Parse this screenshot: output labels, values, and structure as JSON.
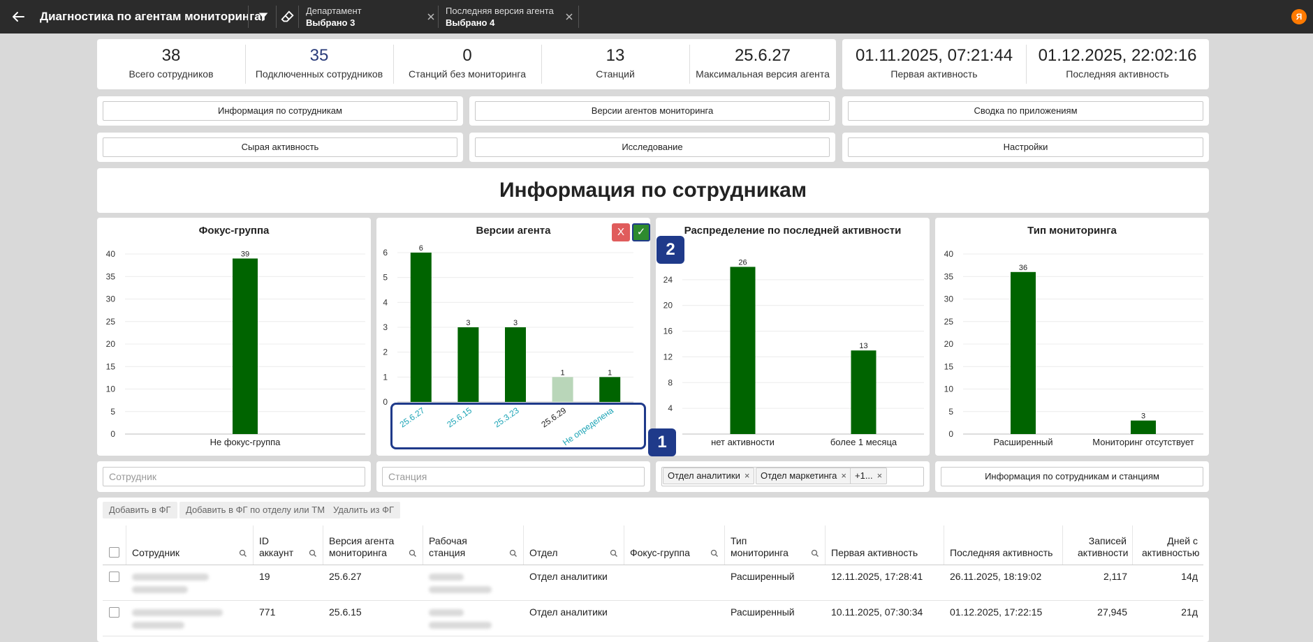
{
  "header": {
    "title": "Диагностика по агентам мониторинга",
    "filters": [
      {
        "label": "Департамент",
        "value": "Выбрано 3"
      },
      {
        "label": "Последняя версия агента",
        "value": "Выбрано 4"
      }
    ],
    "avatar": "Я"
  },
  "kpis": [
    {
      "value": "38",
      "label": "Всего сотрудников"
    },
    {
      "value": "35",
      "label": "Подключенных сотрудников"
    },
    {
      "value": "0",
      "label": "Станций без мониторинга"
    },
    {
      "value": "13",
      "label": "Станций"
    },
    {
      "value": "25.6.27",
      "label": "Максимальная версия агента"
    }
  ],
  "activity": [
    {
      "value": "01.11.2025, 07:21:44",
      "label": "Первая активность"
    },
    {
      "value": "01.12.2025, 22:02:16",
      "label": "Последняя активность"
    }
  ],
  "nav": {
    "row1": [
      "Информация по сотрудникам",
      "Версии агентов мониторинга",
      "Сводка по приложениям"
    ],
    "row2": [
      "Сырая активность",
      "Исследование",
      "Настройки"
    ]
  },
  "section_title": "Информация по сотрудникам",
  "colors": {
    "bar": "#006400",
    "bar_faded": "#b9d6b9",
    "marker": "#1f3a8a",
    "cancel": "#e05c5c",
    "confirm": "#2e8b2e",
    "link": "#1aa3b5"
  },
  "chart_data": [
    {
      "type": "bar",
      "title": "Фокус-группа",
      "categories": [
        "Не фокус-группа"
      ],
      "values": [
        39
      ],
      "ylim": [
        0,
        40
      ],
      "yticks": [
        0,
        5,
        10,
        15,
        20,
        25,
        30,
        35,
        40
      ],
      "grid": true
    },
    {
      "type": "bar",
      "title": "Версии агента",
      "categories": [
        "25.6.27",
        "25.6.15",
        "25.3.23",
        "25.6.29",
        "Не определена"
      ],
      "values": [
        6,
        3,
        3,
        1,
        1
      ],
      "selected": [
        true,
        true,
        true,
        false,
        true
      ],
      "ylim": [
        0,
        6
      ],
      "yticks": [
        0,
        1,
        2,
        3,
        4,
        5,
        6
      ],
      "grid": true
    },
    {
      "type": "bar",
      "title": "Распределение по последней активности",
      "categories": [
        "нет активности",
        "более 1 месяца"
      ],
      "values": [
        26,
        13
      ],
      "ylim": [
        0,
        28
      ],
      "yticks": [
        4,
        8,
        12,
        16,
        20,
        24
      ],
      "grid": true
    },
    {
      "type": "bar",
      "title": "Тип мониторинга",
      "categories": [
        "Расширенный",
        "Мониторинг отсутствует"
      ],
      "values": [
        36,
        3
      ],
      "ylim": [
        0,
        40
      ],
      "yticks": [
        0,
        5,
        10,
        15,
        20,
        25,
        30,
        35,
        40
      ],
      "grid": true
    }
  ],
  "chart_actions": {
    "cancel": "X",
    "confirm": "✓"
  },
  "markers": [
    "1",
    "2"
  ],
  "filters_row": {
    "employee_placeholder": "Сотрудник",
    "station_placeholder": "Станция",
    "tags": [
      "Отдел аналитики",
      "Отдел маркетинга",
      "+1..."
    ],
    "info_button": "Информация по сотрудникам и станциям"
  },
  "table": {
    "actions": [
      "Добавить в ФГ",
      "Добавить в ФГ по отделу или ТМ",
      "Удалить из ФГ"
    ],
    "columns": [
      {
        "label": "Сотрудник"
      },
      {
        "label": "ID аккаунт"
      },
      {
        "label": "Версия агента мониторинга"
      },
      {
        "label": "Рабочая станция"
      },
      {
        "label": "Отдел"
      },
      {
        "label": "Фокус-группа"
      },
      {
        "label": "Тип мониторинга"
      },
      {
        "label": "Первая активность"
      },
      {
        "label": "Последняя активность"
      },
      {
        "label": "Записей активности"
      },
      {
        "label": "Дней с активностью"
      }
    ],
    "rows": [
      {
        "id": "19",
        "version": "25.6.27",
        "department": "Отдел аналитики",
        "focus": "",
        "monitoring": "Расширенный",
        "first": "12.11.2025, 17:28:41",
        "last": "26.11.2025, 18:19:02",
        "records": "2,117",
        "days": "14д"
      },
      {
        "id": "771",
        "version": "25.6.15",
        "department": "Отдел аналитики",
        "focus": "",
        "monitoring": "Расширенный",
        "first": "10.11.2025, 07:30:34",
        "last": "01.12.2025, 17:22:15",
        "records": "27,945",
        "days": "21д"
      }
    ]
  }
}
